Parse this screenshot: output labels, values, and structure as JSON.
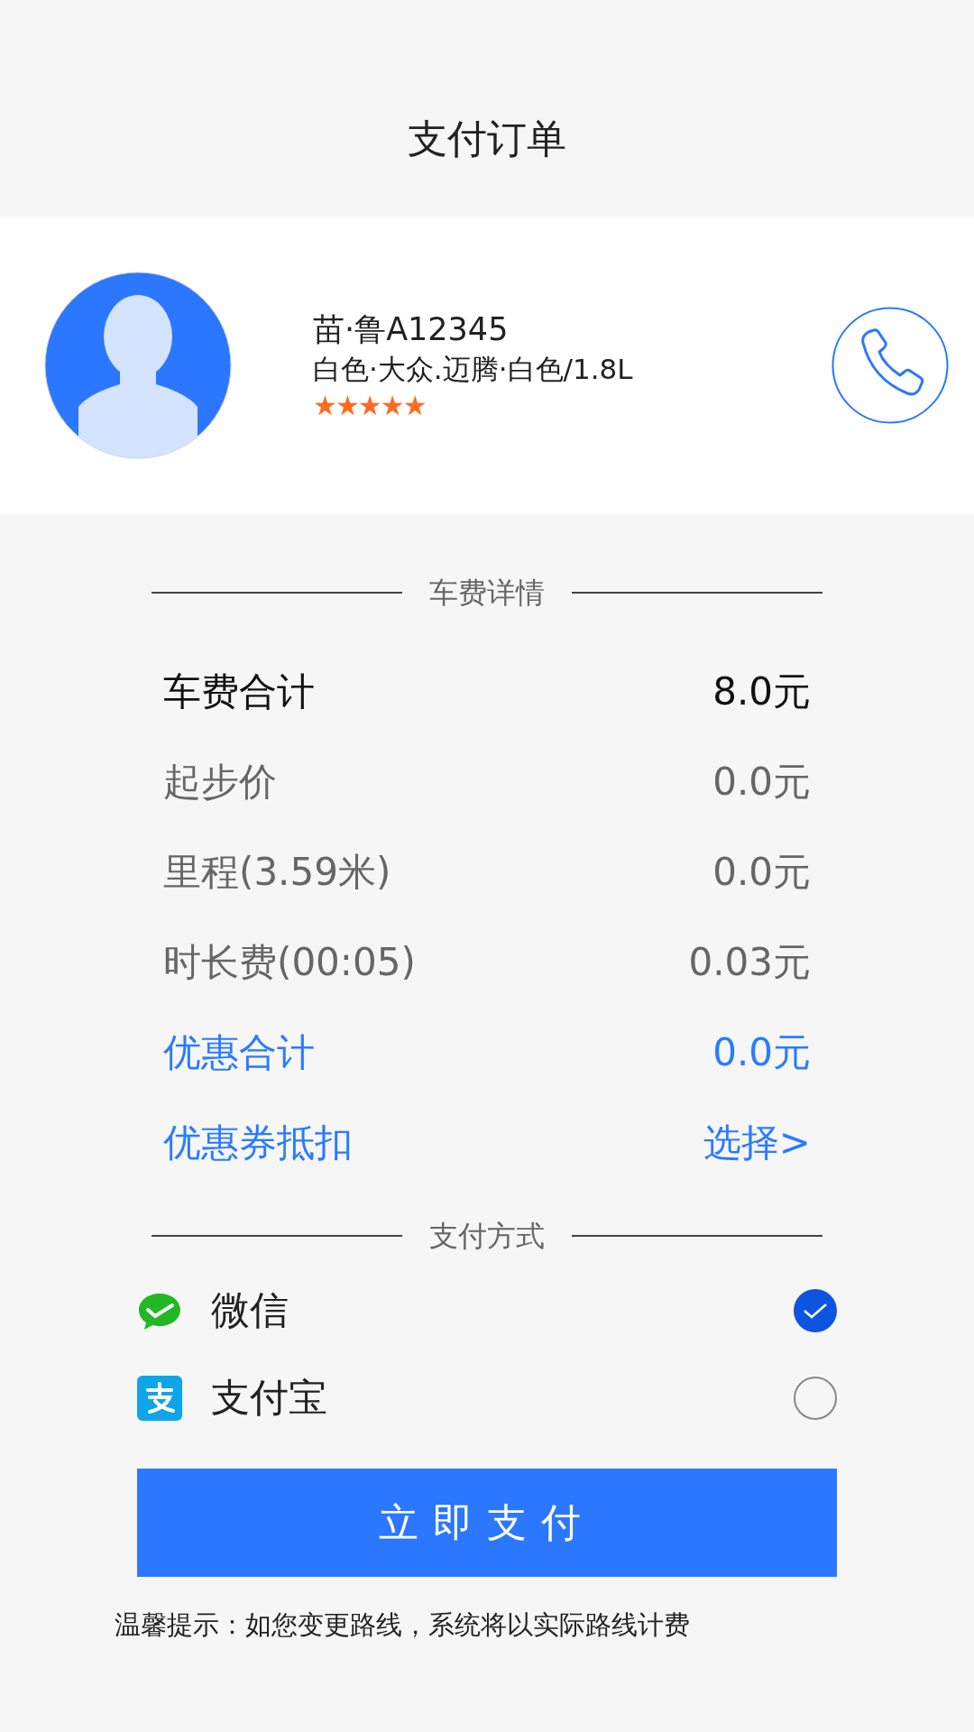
{
  "header": {
    "title": "支付订单"
  },
  "driver": {
    "name": "苗·鲁A12345",
    "car": "白色·大众.迈腾·白色/1.8L",
    "stars": 5
  },
  "fee_section": {
    "title": "车费详情",
    "rows": [
      {
        "kind": "total",
        "label": "车费合计",
        "value": "8.0元"
      },
      {
        "kind": "normal",
        "label": "起步价",
        "value": "0.0元"
      },
      {
        "kind": "normal",
        "label": "里程(3.59米)",
        "value": "0.0元"
      },
      {
        "kind": "normal",
        "label": "时长费(00:05)",
        "value": "0.03元"
      },
      {
        "kind": "discount",
        "label": "优惠合计",
        "value": "0.0元"
      },
      {
        "kind": "discount",
        "label": "优惠券抵扣",
        "value": "选择>"
      }
    ]
  },
  "payment_section": {
    "title": "支付方式",
    "methods": [
      {
        "kind": "wechat",
        "label": "微信",
        "selected": true
      },
      {
        "kind": "alipay",
        "label": "支付宝",
        "selected": false
      }
    ]
  },
  "pay_button": "立即支付",
  "tip": "温馨提示：如您变更路线，系统将以实际路线计费"
}
